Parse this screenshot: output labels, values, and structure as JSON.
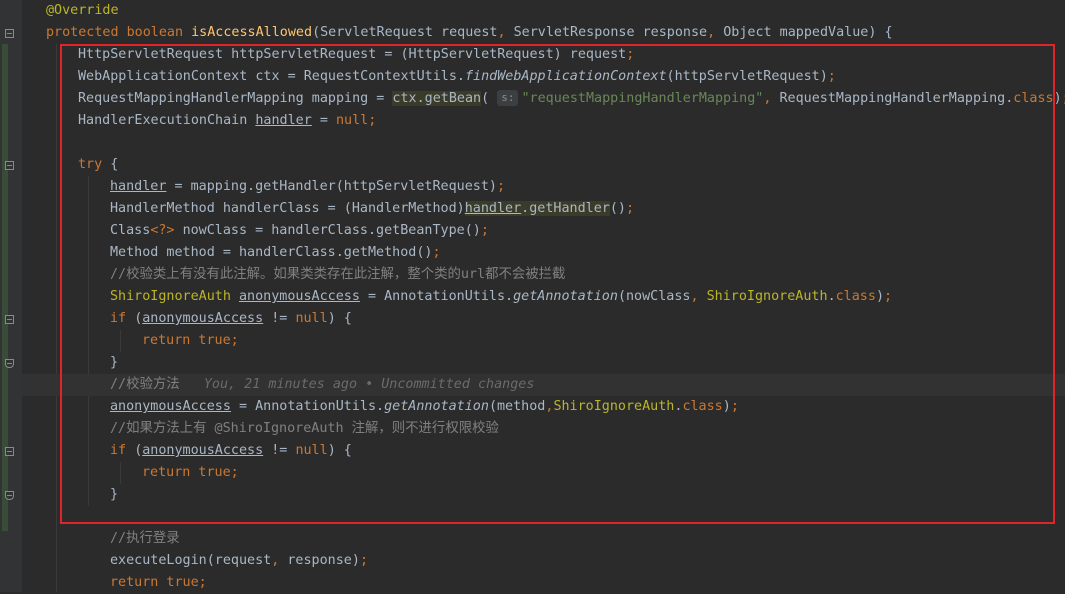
{
  "editor": {
    "code_lines": [
      "@Override",
      "protected boolean isAccessAllowed(ServletRequest request, ServletResponse response, Object mappedValue) {",
      "HttpServletRequest httpServletRequest = (HttpServletRequest) request;",
      "WebApplicationContext ctx = RequestContextUtils.findWebApplicationContext(httpServletRequest);",
      "RequestMappingHandlerMapping mapping = ctx.getBean( s: \"requestMappingHandlerMapping\", RequestMappingHandlerMapping.class);",
      "HandlerExecutionChain handler = null;",
      "",
      "try {",
      "handler = mapping.getHandler(httpServletRequest);",
      "HandlerMethod handlerClass = (HandlerMethod)handler.getHandler();",
      "Class<?> nowClass = handlerClass.getBeanType();",
      "Method method = handlerClass.getMethod();",
      "//校验类上有没有此注解。如果类类存在此注解，整个类的url都不会被拦截",
      "ShiroIgnoreAuth anonymousAccess = AnnotationUtils.getAnnotation(nowClass, ShiroIgnoreAuth.class);",
      "if (anonymousAccess != null) {",
      "return true;",
      "}",
      "//校验方法",
      "anonymousAccess = AnnotationUtils.getAnnotation(method,ShiroIgnoreAuth.class);",
      "//如果方法上有 @ShiroIgnoreAuth 注解，则不进行权限校验",
      "if (anonymousAccess != null) {",
      "return true;",
      "}",
      "",
      "//执行登录",
      "executeLogin(request, response);",
      "return true;"
    ],
    "param_hint": "s:",
    "blame": "You, 21 minutes ago • Uncommitted changes",
    "annotation_box_color": "#e0242a"
  }
}
